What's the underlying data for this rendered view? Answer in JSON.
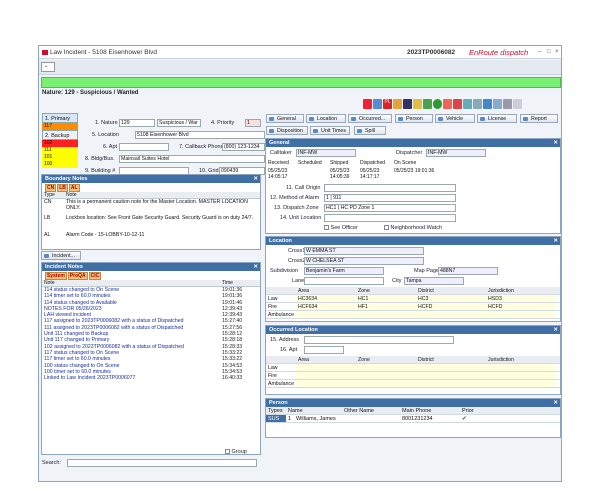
{
  "window": {
    "title": "Law Incident - 5108 Eisenhower Blvd",
    "incident_number": "2023TP0006082",
    "brand": "EnRoute dispatch",
    "min_label": "–",
    "max_label": "□",
    "close_label": "×"
  },
  "banner": {
    "nature_text": "Nature: 129 - Suspicious / Wanted"
  },
  "tabs": {
    "primary": "1. Primary",
    "backup": "2. Backup",
    "priorities": [
      "1",
      "117",
      "102",
      "111",
      "101",
      "100"
    ]
  },
  "form": {
    "nature_label": "1. Nature",
    "nature_code": "129",
    "nature_desc": "Suspicious / War",
    "priority_label": "4. Priority",
    "priority_value": "1",
    "location_label": "5. Location",
    "location_value": "5108 Eisenhower Blvd",
    "apt_label": "6. Apt",
    "callback_label": "7. Callback Phone",
    "callback_value": "(800) 123-1234",
    "bldg_label": "8. Bldg/Bus.",
    "bldg_value": "Mainsail Suites Hotel",
    "building_label": "9. Building #",
    "grid_label": "10. Grid",
    "grid_value": "090439"
  },
  "boundary": {
    "title": "Boundary Notes",
    "tabs": [
      "CN",
      "LB",
      "AL"
    ],
    "columns": [
      "Type",
      "Note"
    ],
    "rows": [
      {
        "type": "CN",
        "note": "This is a permanent caution note for the Master Location.  MASTER LOCATION ONLY."
      },
      {
        "type": "LB",
        "note": "Lockbox location:  See Front Gate Security Guard.  Security Guard is on duty 24/7."
      },
      {
        "type": "AL",
        "note": "Alarm Code - 15-LOBBY-10-12-11"
      }
    ]
  },
  "incident_button": "Incident...",
  "notes": {
    "title": "Incident Notes",
    "tabs": [
      "System",
      "ProQA",
      "CIC"
    ],
    "columns": [
      "Note",
      "Time"
    ],
    "rows": [
      {
        "note": "114 status changed to On Scene",
        "time": "19:01:36"
      },
      {
        "note": "114 timer set to 60.0 minutes",
        "time": "19:01:36"
      },
      {
        "note": "114 status changed to Available",
        "time": "19:01:46"
      },
      {
        "note": "NOTES FOR 05/26/2023",
        "time": "12:39:43"
      },
      {
        "note": "LAH viewed incident",
        "time": "12:39:43"
      },
      {
        "note": "117 assigned to 2023TP0006082 with a status of Dispatched",
        "time": "15:27:40"
      },
      {
        "note": "111 assigned to 2023TP0006082 with a status of Dispatched",
        "time": "15:27:56"
      },
      {
        "note": "Unit 111 changed to Backup",
        "time": "15:28:12"
      },
      {
        "note": "Unit 117 changed to Primary",
        "time": "15:28:18"
      },
      {
        "note": "102 assigned to 2023TP0006082 with a status of Dispatched",
        "time": "15:28:33"
      },
      {
        "note": "117 status changed to On Scene",
        "time": "15:33:22"
      },
      {
        "note": "117 timer set to 60.0 minutes",
        "time": "15:33:22"
      },
      {
        "note": "100 status changed to On Scene",
        "time": "15:34:53"
      },
      {
        "note": "100 timer set to 60.0 minutes",
        "time": "15:34:53"
      },
      {
        "note": "Linked to Law Incident 2023TP0006077",
        "time": "16:40:33"
      }
    ],
    "group_label": "Group",
    "search_label": "Search:"
  },
  "actions": {
    "general": "General",
    "location": "Location",
    "occurred": "Occurred...",
    "person": "Person",
    "vehicle": "Vehicle",
    "license": "License",
    "report": "Report",
    "disposition": "Disposition",
    "unit_times": "Unit Times",
    "spill": "Spill"
  },
  "general": {
    "title": "General",
    "calltaker_label": "Calltaker",
    "calltaker_value": "INF-MW",
    "dispatcher_label": "Dispatcher",
    "dispatcher_value": "INF-MW",
    "time_headers": [
      "Received",
      "Scheduled",
      "Shipped",
      "Dispatched",
      "On Scene"
    ],
    "received": "05/25/23 14:05:17",
    "shipped": "05/25/23 14:05:39",
    "dispatched": "05/25/23 14:17:17",
    "on_scene": "05/25/23 19:01:36",
    "call_origin_label": "11. Call Origin",
    "alarm_label": "12. Method of Alarm",
    "alarm_value": "1 | 911",
    "zone_label": "13. Dispatch Zone",
    "zone_value": "HC1 | HC PD Zone 1",
    "unit_loc_label": "14. Unit Location",
    "see_officer": "See Officer",
    "neighborhood_watch": "Neighborhood Watch"
  },
  "location": {
    "title": "Location",
    "cross1_label": "Cross1",
    "cross1": "W EMMA ST",
    "cross2_label": "Cross2",
    "cross2": "W CHELSEA ST",
    "subdivision_label": "Subdivision",
    "subdivision": "Benjamin's Farm",
    "mappage_label": "Map Page",
    "mappage": "488N7",
    "lane_label": "Lane",
    "city_label": "City",
    "city": "Tampa",
    "columns": [
      "",
      "Area",
      "Zone",
      "District",
      "Jurisdiction"
    ],
    "rows": [
      [
        "Law",
        "HC3634",
        "HC1",
        "HC3",
        "HSD3"
      ],
      [
        "Fire",
        "HCF634",
        "HF1",
        "HCFD",
        "HCFD"
      ],
      [
        "Ambulance",
        "",
        "",
        "",
        ""
      ]
    ]
  },
  "occurred": {
    "title": "Occurred Location",
    "address_label": "15. Address",
    "apt_label": "16. Apt",
    "columns": [
      "",
      "Area",
      "Zone",
      "District",
      "Jurisdiction"
    ],
    "rows": [
      "Law",
      "Fire",
      "Ambulance"
    ]
  },
  "person": {
    "title": "Person",
    "columns": [
      "Types",
      "Name",
      "Other Name",
      "Main Phone",
      "Prior"
    ],
    "row": {
      "type": "SUS",
      "index": "1",
      "name": "Williams, James",
      "phone": "8001231234"
    }
  },
  "colors": {
    "accent": "#3f6fa5",
    "banner": "#79f073",
    "brand": "#c8102e"
  }
}
